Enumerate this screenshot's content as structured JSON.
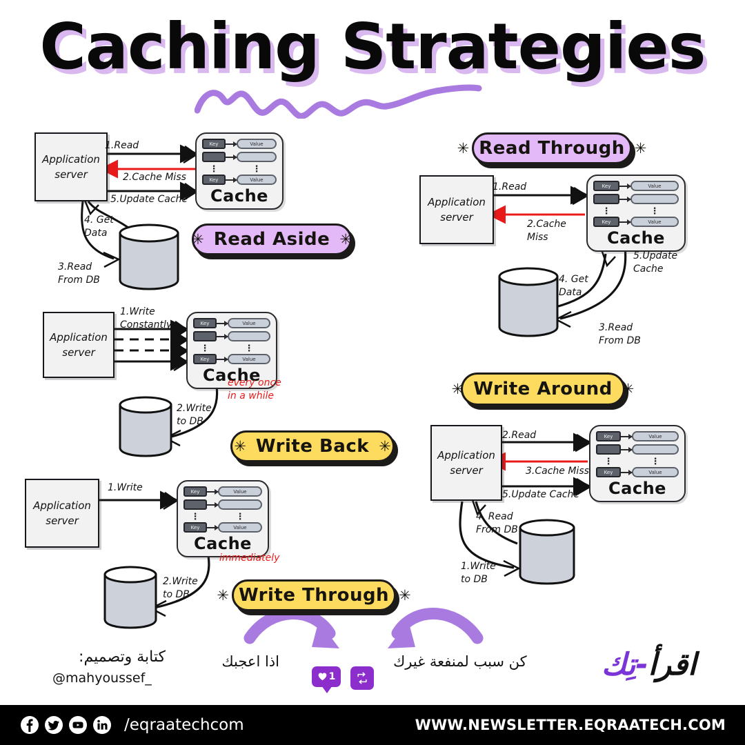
{
  "title": "Caching Strategies",
  "colors": {
    "purple_pill": "#e3b9f7",
    "yellow_pill": "#fcdb5e",
    "accent_purple": "#a97ae0",
    "brand_purple": "#7b35d6",
    "red": "#e81a1a",
    "outline": "#1d1a1a",
    "box_fill": "#f2f2f2",
    "db_fill": "#ccd1da",
    "key_fill": "#5e636b",
    "value_fill": "#c9d0da"
  },
  "common": {
    "server_line1": "Application",
    "server_line2": "server",
    "cache_label": "Cache",
    "key_label": "Key",
    "value_label": "Value",
    "dots": "⋮",
    "star": "✳"
  },
  "strategies": [
    {
      "id": "read-aside",
      "name": "Read Aside",
      "badge_color": "purple",
      "steps": [
        "1.Read",
        "2.Cache Miss",
        "5.Update Cache",
        "4. Get\nData",
        "3.Read\nFrom DB"
      ]
    },
    {
      "id": "read-through",
      "name": "Read Through",
      "badge_color": "purple",
      "steps": [
        "1.Read",
        "2.Cache\nMiss",
        "5.Update\nCache",
        "4. Get\nData",
        "3.Read\nFrom DB"
      ]
    },
    {
      "id": "write-back",
      "name": "Write Back",
      "badge_color": "yellow",
      "steps": [
        "1.Write\nConstantly",
        "2.Write\nto DB"
      ],
      "annotation": "every once\nin a while"
    },
    {
      "id": "write-around",
      "name": "Write Around",
      "badge_color": "yellow",
      "steps": [
        "2.Read",
        "3.Cache Miss",
        "5.Update Cache",
        "4. Read\nFrom DB",
        "1.Write\nto DB"
      ]
    },
    {
      "id": "write-through",
      "name": "Write Through",
      "badge_color": "yellow",
      "steps": [
        "1.Write",
        "2.Write\nto DB"
      ],
      "annotation": "immediately"
    }
  ],
  "credits": {
    "arabic_label": "كتابة وتصميم:",
    "handle": "@mahyoussef_"
  },
  "cta": {
    "left_text": "اذا اعجبك",
    "right_text": "كن سبب لمنفعة غيرك",
    "like_count": "1"
  },
  "brand": {
    "black_part": "اقرأ",
    "separator": "-",
    "purple_part": "تِك"
  },
  "footer": {
    "handle": "/eqraatechcom",
    "website": "WWW.NEWSLETTER.EQRAATECH.COM",
    "socials": [
      "facebook-icon",
      "twitter-icon",
      "youtube-icon",
      "linkedin-icon"
    ]
  }
}
